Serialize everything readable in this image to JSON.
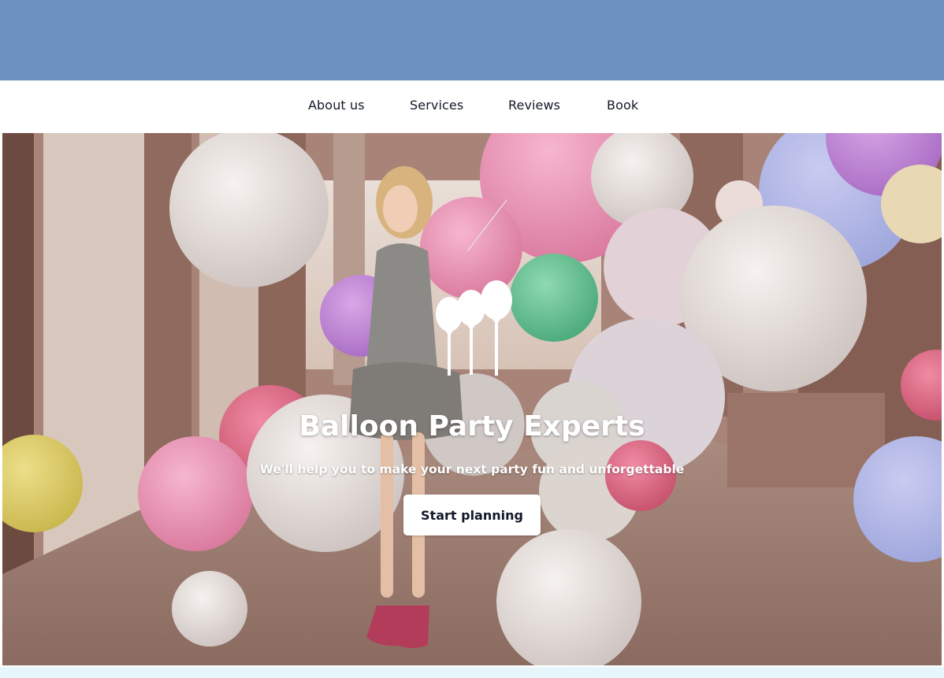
{
  "nav": {
    "items": [
      {
        "label": "About us"
      },
      {
        "label": "Services"
      },
      {
        "label": "Reviews"
      },
      {
        "label": "Book"
      }
    ]
  },
  "hero": {
    "logo_icon": "balloons-icon",
    "title": "Balloon Party Experts",
    "subtitle": "We'll help you to make your next party fun and unforgettable",
    "cta_label": "Start planning",
    "background_image": "girl-with-balloons-photo"
  },
  "colors": {
    "top_band": "#6d91c0",
    "nav_background": "#ffffff",
    "page_background": "#e6f6fa"
  }
}
